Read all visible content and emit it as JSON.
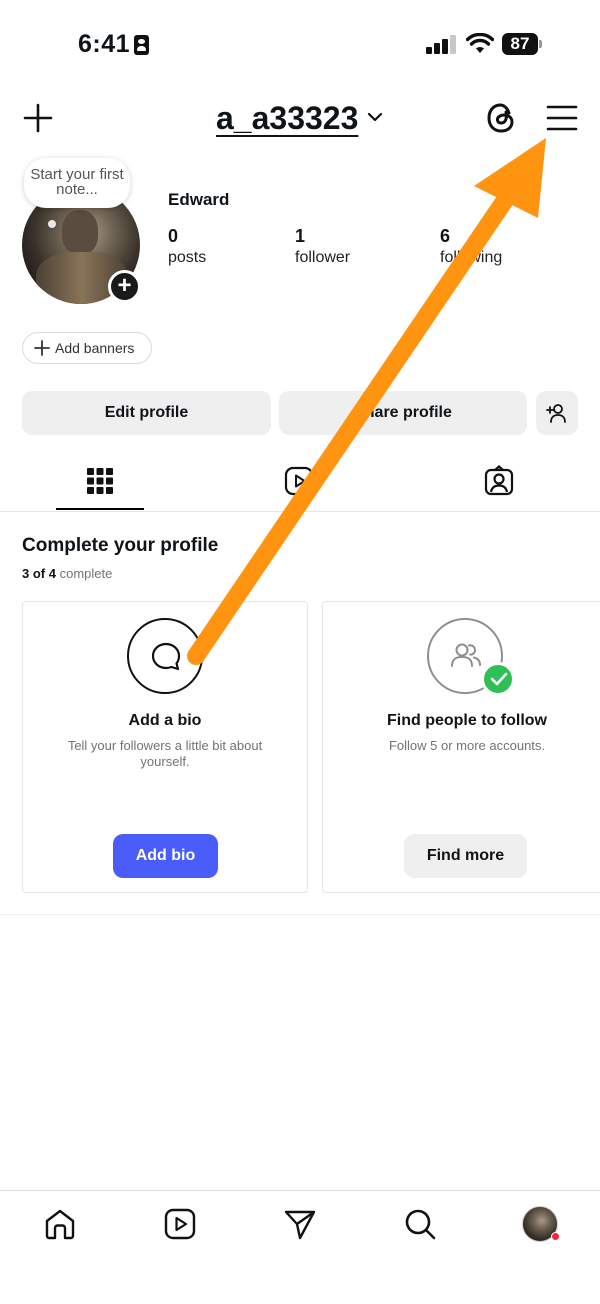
{
  "status_bar": {
    "time": "6:41",
    "battery": "87"
  },
  "header": {
    "username": "a_a33323"
  },
  "profile": {
    "note_placeholder": "Start your first note...",
    "name": "Edward",
    "stats": [
      {
        "value": "0",
        "label": "posts"
      },
      {
        "value": "1",
        "label": "follower"
      },
      {
        "value": "6",
        "label": "following"
      }
    ],
    "add_banners_label": "Add banners",
    "edit_profile_label": "Edit profile",
    "share_profile_label": "Share profile"
  },
  "complete_profile": {
    "title": "Complete your profile",
    "progress_count": "3 of 4",
    "progress_suffix": "complete",
    "cards": [
      {
        "title": "Add a bio",
        "description": "Tell your followers a little bit about yourself.",
        "button": "Add bio"
      },
      {
        "title": "Find people to follow",
        "description": "Follow 5 or more accounts.",
        "button": "Find more"
      }
    ]
  },
  "colors": {
    "primary_button": "#4a5df9",
    "grey_button": "#efefef",
    "success_green": "#2fbf55",
    "annotation_arrow": "#ff9410",
    "notification_dot": "#ff1f3d"
  },
  "icons": {
    "header": [
      "plus-icon",
      "chevron-down-icon",
      "threads-icon",
      "menu-icon"
    ],
    "tabs": [
      "grid-icon",
      "reels-icon",
      "tagged-icon"
    ],
    "bottom_nav": [
      "home-icon",
      "reels-icon",
      "direct-message-icon",
      "search-icon",
      "profile-avatar"
    ]
  }
}
